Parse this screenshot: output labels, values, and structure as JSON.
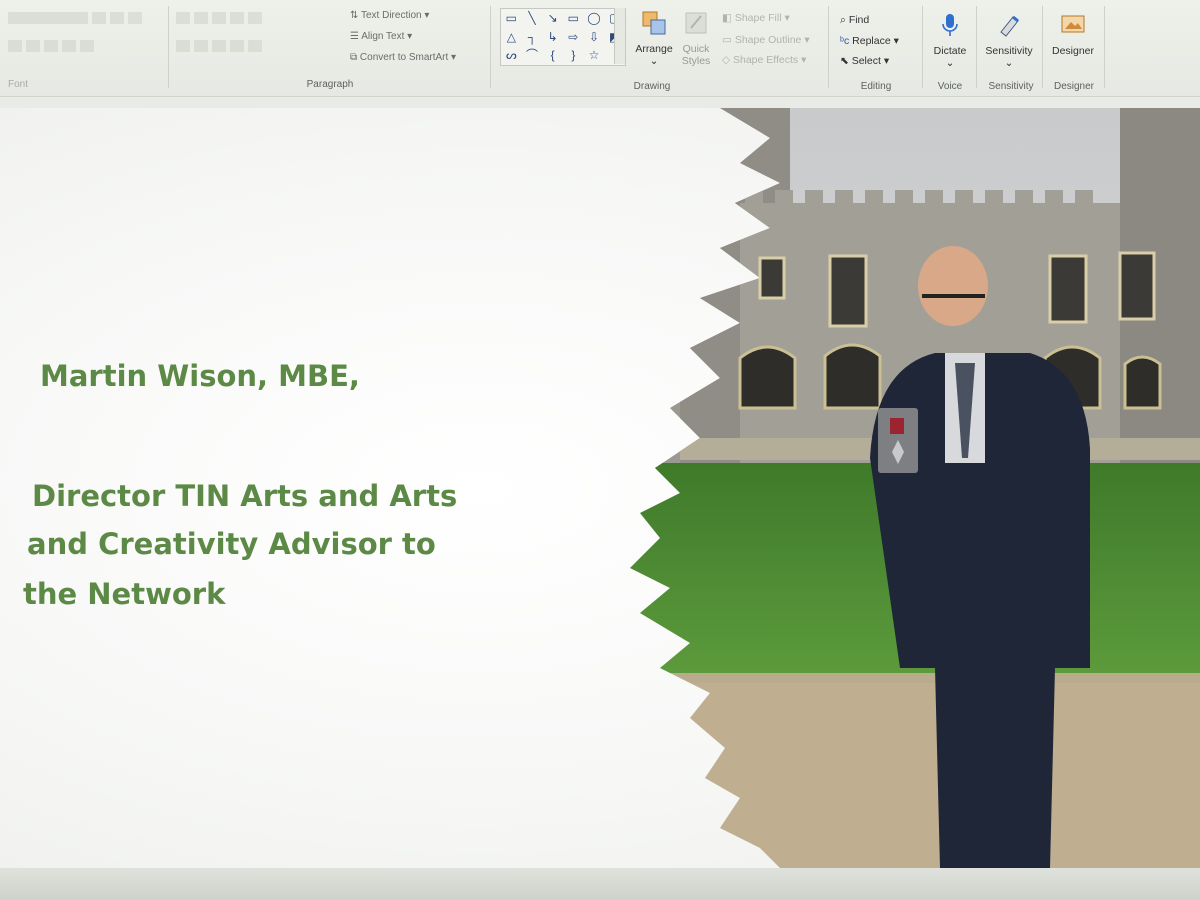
{
  "ribbon": {
    "font_group_label": "Font",
    "paragraph": {
      "label": "Paragraph",
      "text_direction": "Text Direction",
      "align_text": "Align Text",
      "convert_smartart": "Convert to SmartArt"
    },
    "drawing": {
      "label": "Drawing",
      "arrange": "Arrange",
      "quick_styles": "Quick Styles",
      "shape_fill": "Shape Fill",
      "shape_outline": "Shape Outline",
      "shape_effects": "Shape Effects"
    },
    "editing": {
      "label": "Editing",
      "find": "Find",
      "replace": "Replace",
      "select": "Select"
    },
    "voice": {
      "label": "Voice",
      "dictate": "Dictate"
    },
    "sensitivity": {
      "label": "Sensitivity",
      "button": "Sensitivity"
    },
    "designer": {
      "label": "Designer",
      "button": "Designer"
    },
    "icons": [
      "text-direction-icon",
      "align-text-icon",
      "smartart-icon",
      "arrange-icon",
      "quick-styles-icon",
      "shape-fill-icon",
      "shape-outline-icon",
      "shape-effects-icon",
      "search-icon",
      "replace-icon",
      "cursor-icon",
      "microphone-icon",
      "sensitivity-icon",
      "designer-icon"
    ]
  },
  "slide": {
    "name_line": "Martin Wison, MBE,",
    "role_lines": [
      "Director TIN Arts and Arts",
      "and Creativity Advisor to",
      "the Network"
    ],
    "text_color": "#5c8a46"
  }
}
